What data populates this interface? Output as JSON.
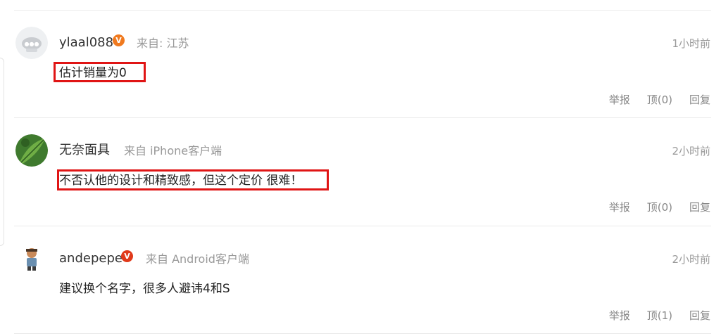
{
  "comments": [
    {
      "username": "ylaal088",
      "verified": true,
      "badge_text": "V",
      "badge_color": "#f07a1f",
      "source": "来自: 江苏",
      "time": "1小时前",
      "text": "估计销量为0",
      "highlighted": true,
      "actions": {
        "report": "举报",
        "upvote": "顶(0)",
        "reply": "回复"
      }
    },
    {
      "username": "无奈面具",
      "verified": false,
      "source": "来自 iPhone客户端",
      "time": "2小时前",
      "text": "不否认他的设计和精致感，但这个定价 很难！",
      "highlighted": true,
      "actions": {
        "report": "举报",
        "upvote": "顶(0)",
        "reply": "回复"
      }
    },
    {
      "username": "andepepe",
      "verified": true,
      "badge_text": "V",
      "badge_color": "#e0391a",
      "source": "来自 Android客户端",
      "time": "2小时前",
      "text": "建议换个名字，很多人避讳4和S",
      "highlighted": false,
      "actions": {
        "report": "举报",
        "upvote": "顶(1)",
        "reply": "回复"
      }
    }
  ],
  "colors": {
    "highlight_border": "#e01515",
    "divider": "#ebebeb",
    "meta_text": "#999999"
  }
}
